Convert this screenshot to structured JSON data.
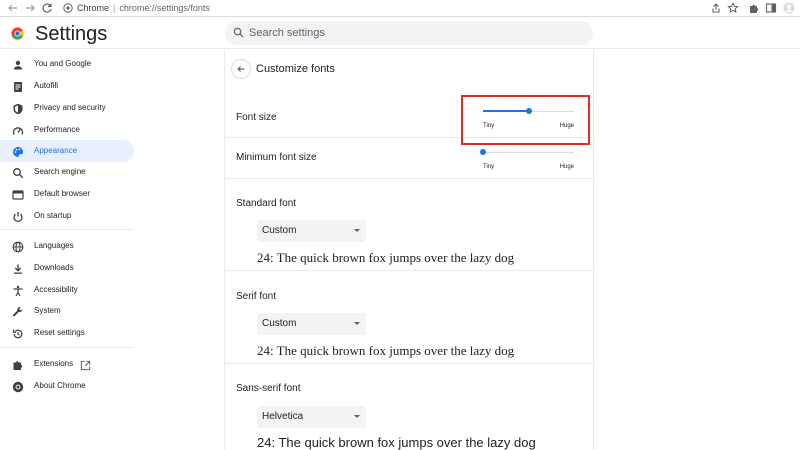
{
  "toolbar": {
    "site": "Chrome",
    "separator": "|",
    "url_path": "chrome://settings/fonts"
  },
  "header": {
    "title": "Settings",
    "search_placeholder": "Search settings"
  },
  "sidebar": {
    "items": [
      {
        "label": "You and Google",
        "icon": "person-icon"
      },
      {
        "label": "Autofill",
        "icon": "autofill-icon"
      },
      {
        "label": "Privacy and security",
        "icon": "shield-icon"
      },
      {
        "label": "Performance",
        "icon": "speedometer-icon"
      },
      {
        "label": "Appearance",
        "icon": "palette-icon",
        "active": true
      },
      {
        "label": "Search engine",
        "icon": "search-icon"
      },
      {
        "label": "Default browser",
        "icon": "browser-icon"
      },
      {
        "label": "On startup",
        "icon": "power-icon"
      },
      {
        "label": "Languages",
        "icon": "globe-icon"
      },
      {
        "label": "Downloads",
        "icon": "download-icon"
      },
      {
        "label": "Accessibility",
        "icon": "accessibility-icon"
      },
      {
        "label": "System",
        "icon": "wrench-icon"
      },
      {
        "label": "Reset settings",
        "icon": "reset-icon"
      },
      {
        "label": "Extensions",
        "icon": "extensions-icon"
      },
      {
        "label": "About Chrome",
        "icon": "chrome-icon"
      }
    ]
  },
  "main": {
    "title": "Customize fonts",
    "font_size": {
      "label": "Font size",
      "min_label": "Tiny",
      "max_label": "Huge",
      "value_fraction": 0.5
    },
    "min_font_size": {
      "label": "Minimum font size",
      "min_label": "Tiny",
      "max_label": "Huge",
      "value_fraction": 0.0
    },
    "standard_font": {
      "label": "Standard font",
      "selected": "Custom",
      "sample": "24: The quick brown fox jumps over the lazy dog"
    },
    "serif_font": {
      "label": "Serif font",
      "selected": "Custom",
      "sample": "24: The quick brown fox jumps over the lazy dog"
    },
    "sans_serif_font": {
      "label": "Sans-serif font",
      "selected": "Helvetica",
      "sample": "24: The quick brown fox jumps over the lazy dog"
    }
  },
  "colors": {
    "accent": "#1a73e8",
    "active_bg": "#e8f0fe",
    "highlight": "#d93025"
  }
}
